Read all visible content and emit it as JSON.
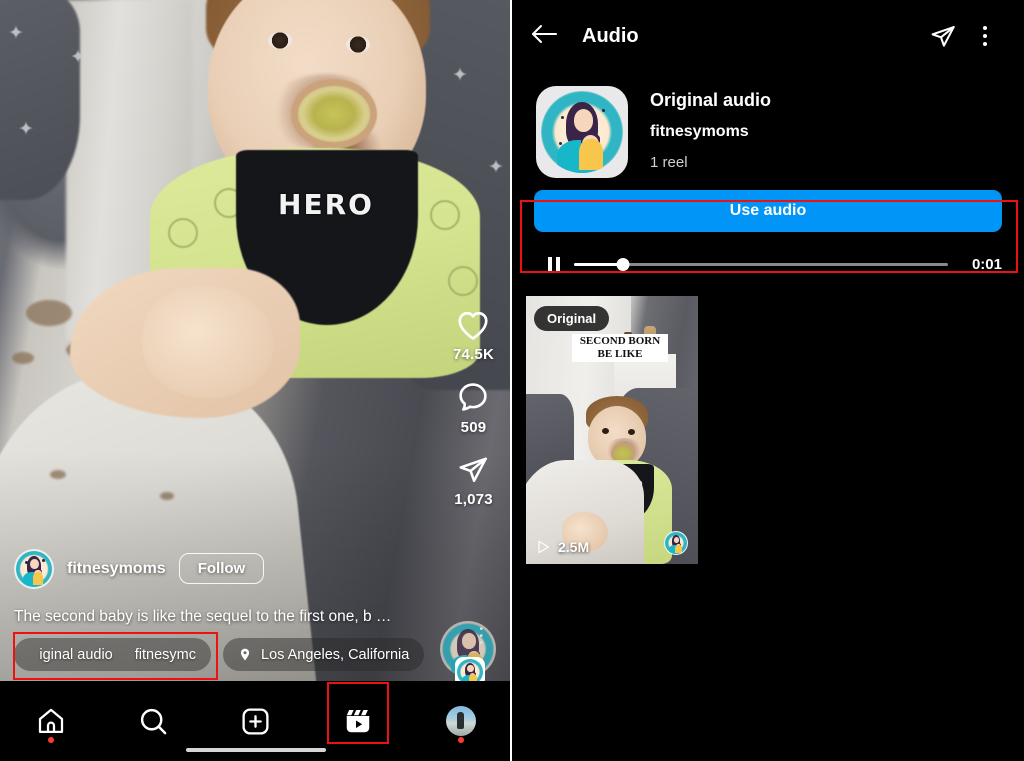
{
  "reel_player": {
    "user": {
      "username": "fitnesymoms",
      "follow_label": "Follow",
      "avatar_icon": "mother-baby-avatar"
    },
    "caption": "The second baby is like the sequel to the first one, b …",
    "actions": [
      {
        "icon": "heart-icon",
        "count": "74.5K",
        "name": "like"
      },
      {
        "icon": "comment-icon",
        "count": "509",
        "name": "comment"
      },
      {
        "icon": "share-icon",
        "count": "1,073",
        "name": "share"
      }
    ],
    "audio_pill": {
      "icon": "music-note-icon",
      "text_primary": "iginal audio",
      "text_secondary": "fitnesymc"
    },
    "location_pill": {
      "icon": "location-pin-icon",
      "text": "Los Angeles, California"
    },
    "audio_disc_icon": "spinning-audio-disc",
    "tabbar": [
      {
        "name": "home",
        "icon": "home-icon",
        "badge": true,
        "active": false
      },
      {
        "name": "search",
        "icon": "search-icon",
        "badge": false,
        "active": false
      },
      {
        "name": "create",
        "icon": "plus-square-icon",
        "badge": false,
        "active": false
      },
      {
        "name": "reels",
        "icon": "reels-icon",
        "badge": false,
        "active": true
      },
      {
        "name": "profile",
        "icon": "profile-avatar-icon",
        "badge": true,
        "active": false
      }
    ]
  },
  "audio_page": {
    "header": {
      "back_icon": "back-arrow-icon",
      "title": "Audio",
      "share_icon": "share-icon",
      "more_icon": "more-options-icon"
    },
    "audio": {
      "cover_icon": "mother-baby-avatar",
      "title": "Original audio",
      "author": "fitnesymoms",
      "reel_count": "1 reel"
    },
    "use_audio_label": "Use audio",
    "player": {
      "pause_icon": "pause-icon",
      "progress_percent": 13,
      "time": "0:01"
    },
    "reels": [
      {
        "badge": "Original",
        "overlay_caption_line1": "SECOND BORN",
        "overlay_caption_line2": "BE LIKE",
        "play_icon": "play-icon",
        "plays": "2.5M",
        "avatar_icon": "mother-baby-avatar"
      }
    ]
  },
  "annotations": {
    "color": "#ee1111",
    "boxes": [
      {
        "name": "use-audio-highlight"
      },
      {
        "name": "audio-pill-highlight"
      },
      {
        "name": "reels-tab-highlight"
      }
    ]
  }
}
